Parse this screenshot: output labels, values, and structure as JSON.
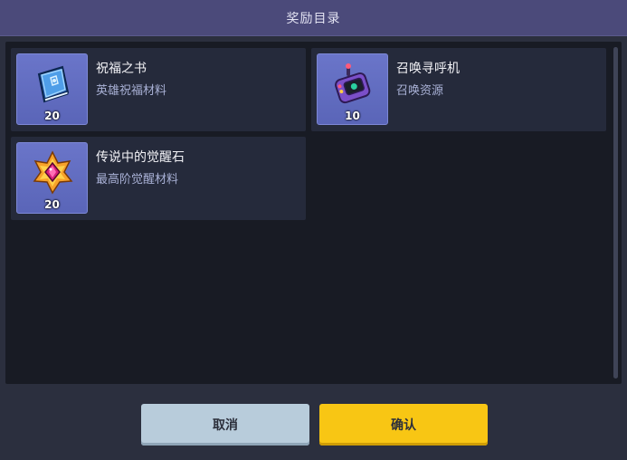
{
  "dialog": {
    "title": "奖励目录"
  },
  "rewards": [
    {
      "name": "祝福之书",
      "description": "英雄祝福材料",
      "quantity": "20",
      "icon": "blessing-book-icon"
    },
    {
      "name": "召唤寻呼机",
      "description": "召唤资源",
      "quantity": "10",
      "icon": "summon-pager-icon"
    },
    {
      "name": "传说中的觉醒石",
      "description": "最高阶觉醒材料",
      "quantity": "20",
      "icon": "awakening-stone-icon"
    }
  ],
  "buttons": {
    "cancel_label": "取消",
    "confirm_label": "确认"
  },
  "colors": {
    "title_bar": "#4b4a7a",
    "panel": "#181b24",
    "card": "#252a3b",
    "thumb": "#6a75c9",
    "cancel": "#b8ccdb",
    "confirm": "#f8c614"
  }
}
